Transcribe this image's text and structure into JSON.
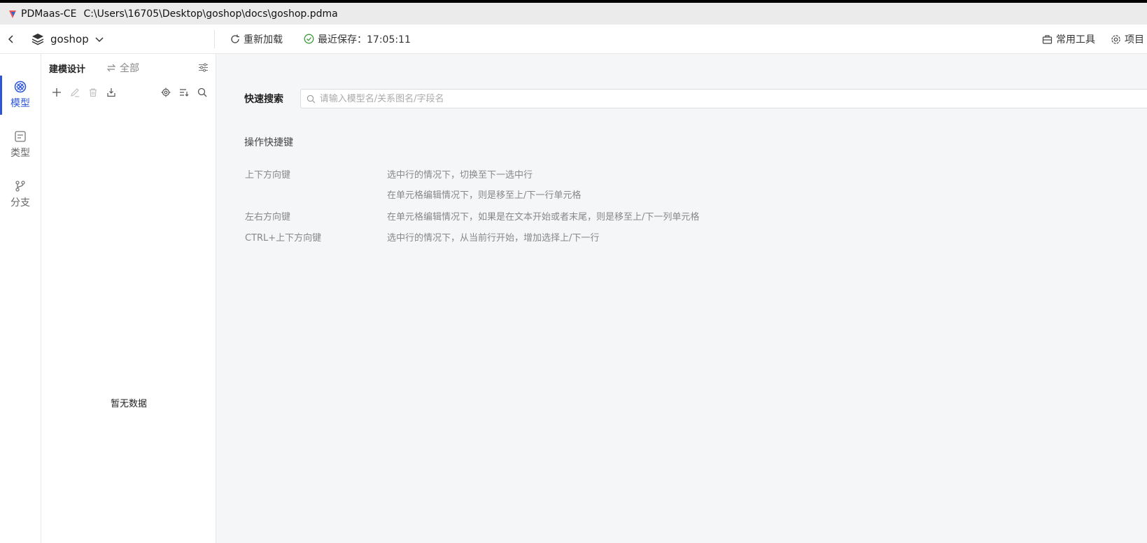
{
  "window": {
    "app_name": "PDMaas-CE",
    "file_path": "C:\\Users\\16705\\Desktop\\goshop\\docs\\goshop.pdma"
  },
  "toolbar": {
    "project_name": "goshop",
    "reload_label": "重新加载",
    "saved_label": "最近保存：17:05:11",
    "tools_label": "常用工具",
    "project_settings_label": "项目"
  },
  "leftnav": {
    "items": [
      {
        "label": "模型",
        "icon": "model-icon",
        "active": true
      },
      {
        "label": "类型",
        "icon": "type-icon",
        "active": false
      },
      {
        "label": "分支",
        "icon": "branch-icon",
        "active": false
      }
    ]
  },
  "sidepanel": {
    "title": "建模设计",
    "filter_label": "全部",
    "empty_text": "暂无数据"
  },
  "main": {
    "search_label": "快速搜索",
    "search_placeholder": "请输入模型名/关系图名/字段名",
    "search_value": "",
    "shortcuts_title": "操作快捷键",
    "shortcuts": [
      {
        "key": "上下方向键",
        "desc": "选中行的情况下，切换至下一选中行"
      },
      {
        "key": "",
        "desc": "在单元格编辑情况下，则是移至上/下一行单元格"
      },
      {
        "key": "左右方向键",
        "desc": "在单元格编辑情况下，如果是在文本开始或者末尾，则是移至上/下一列单元格"
      },
      {
        "key": "CTRL+上下方向键",
        "desc": "选中行的情况下，从当前行开始，增加选择上/下一行"
      }
    ]
  },
  "colors": {
    "accent": "#2c55d8",
    "main_bg": "#f5f6f8",
    "titlebar_bg": "#ebebeb",
    "success": "#3a9a3a"
  }
}
